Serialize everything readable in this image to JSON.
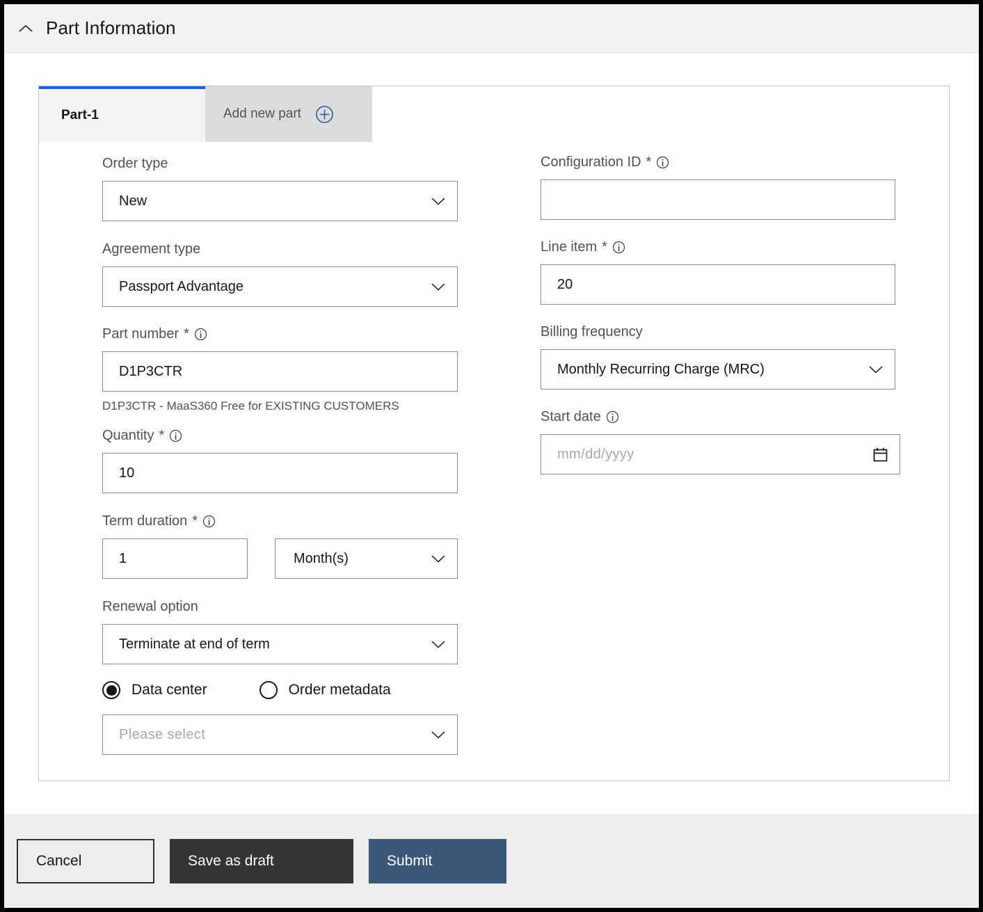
{
  "header": {
    "title": "Part Information",
    "collapse_icon": "chevron-up-icon"
  },
  "tabs": [
    {
      "label": "Part-1",
      "active": true
    },
    {
      "label": "Add new part",
      "active": false,
      "icon": "plus-circle-icon"
    }
  ],
  "form": {
    "left": {
      "order_type": {
        "label": "Order type",
        "value": "New",
        "icon": "chevron-down-icon"
      },
      "agreement_type": {
        "label": "Agreement type",
        "value": "Passport Advantage",
        "icon": "chevron-down-icon"
      },
      "part_number": {
        "label": "Part number",
        "required": "*",
        "info_icon": "info-icon",
        "value": "D1P3CTR",
        "helper": "D1P3CTR - MaaS360 Free for EXISTING CUSTOMERS"
      },
      "quantity": {
        "label": "Quantity",
        "required": "*",
        "info_icon": "info-icon",
        "value": "10"
      },
      "term_duration": {
        "label": "Term duration",
        "required": "*",
        "info_icon": "info-icon",
        "value": "1",
        "unit": "Month(s)",
        "unit_icon": "chevron-down-icon"
      },
      "renewal_option": {
        "label": "Renewal option",
        "value": "Terminate at end of term",
        "icon": "chevron-down-icon"
      },
      "radio_group": {
        "options": [
          {
            "label": "Data center",
            "selected": true
          },
          {
            "label": "Order metadata",
            "selected": false
          }
        ]
      },
      "data_center_select": {
        "value": "Please select",
        "icon": "chevron-down-icon"
      }
    },
    "right": {
      "configuration_id": {
        "label": "Configuration ID",
        "required": "*",
        "info_icon": "info-icon",
        "value": "",
        "placeholder": ""
      },
      "line_item": {
        "label": "Line item",
        "required": "*",
        "info_icon": "info-icon",
        "value": "20"
      },
      "billing_frequency": {
        "label": "Billing frequency",
        "value": "Monthly Recurring Charge (MRC)",
        "icon": "chevron-down-icon"
      },
      "start_date": {
        "label": "Start date",
        "info_icon": "info-icon",
        "value": "",
        "placeholder": "mm/dd/yyyy",
        "icon": "calendar-icon"
      }
    }
  },
  "footer": {
    "cancel_label": "Cancel",
    "save_draft_label": "Save as draft",
    "submit_label": "Submit"
  },
  "colors": {
    "active_tab_accent": "#0f62fe",
    "submit_bg": "#39587a",
    "draft_bg": "#343434",
    "header_bg": "#f2f2f2",
    "footer_bg": "#ededed"
  }
}
